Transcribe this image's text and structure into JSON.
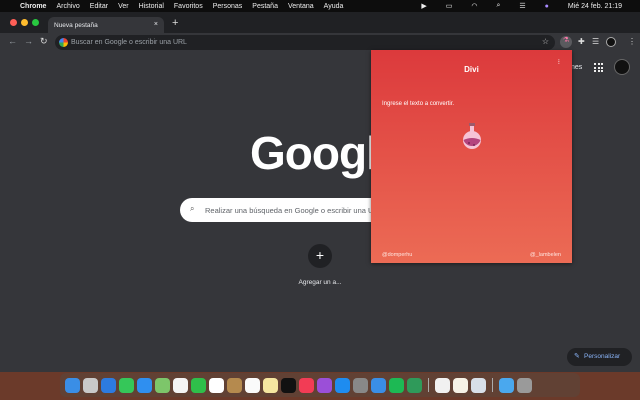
{
  "menubar": {
    "items": [
      "Chrome",
      "Archivo",
      "Editar",
      "Ver",
      "Historial",
      "Favoritos",
      "Personas",
      "Pestaña",
      "Ventana",
      "Ayuda"
    ],
    "datetime": "Mié 24 feb.  21:19"
  },
  "tab": {
    "title": "Nueva pestaña",
    "close": "×",
    "new_tab": "+"
  },
  "toolbar": {
    "omnibox_placeholder": "Buscar en Google o escribir una URL"
  },
  "ntp": {
    "logo": "Google",
    "search_placeholder": "Realizar una búsqueda en Google o escribir una URL",
    "add_shortcut": "Agregar un a...",
    "images_link": "nes",
    "customize": "Personalizar"
  },
  "popup": {
    "title": "Divi",
    "menu": "⁝",
    "prompt": "Ingrese el texto a convertir.",
    "footer_left": "@domperhu",
    "footer_right": "@_lambelen"
  },
  "dock": {
    "apps": [
      {
        "name": "finder",
        "color": "#3a8ee6"
      },
      {
        "name": "launchpad",
        "color": "#c9c9c9"
      },
      {
        "name": "safari",
        "color": "#2d7be0"
      },
      {
        "name": "messages",
        "color": "#35c759"
      },
      {
        "name": "mail",
        "color": "#2f8ff0"
      },
      {
        "name": "maps",
        "color": "#7dc66a"
      },
      {
        "name": "photos",
        "color": "#f4f4f4"
      },
      {
        "name": "facetime",
        "color": "#2fbf4a"
      },
      {
        "name": "calendar",
        "color": "#ffffff"
      },
      {
        "name": "contacts",
        "color": "#b58a4e"
      },
      {
        "name": "reminders",
        "color": "#fafafa"
      },
      {
        "name": "notes",
        "color": "#f5e6a0"
      },
      {
        "name": "tv",
        "color": "#111111"
      },
      {
        "name": "music",
        "color": "#f23c55"
      },
      {
        "name": "podcasts",
        "color": "#9b4fd8"
      },
      {
        "name": "app-store",
        "color": "#1e8cf0"
      },
      {
        "name": "system-preferences",
        "color": "#888888"
      },
      {
        "name": "xcode",
        "color": "#3a8ee6"
      },
      {
        "name": "spotify",
        "color": "#1db954"
      },
      {
        "name": "screen-sharing",
        "color": "#2f9a5a"
      },
      {
        "name": "chrome",
        "color": "#f1f1f1"
      },
      {
        "name": "textedit",
        "color": "#f6f2e6"
      },
      {
        "name": "preview",
        "color": "#d8dfe8"
      },
      {
        "name": "folder",
        "color": "#4aa8ee"
      },
      {
        "name": "trash",
        "color": "#9a9a9a"
      }
    ]
  }
}
